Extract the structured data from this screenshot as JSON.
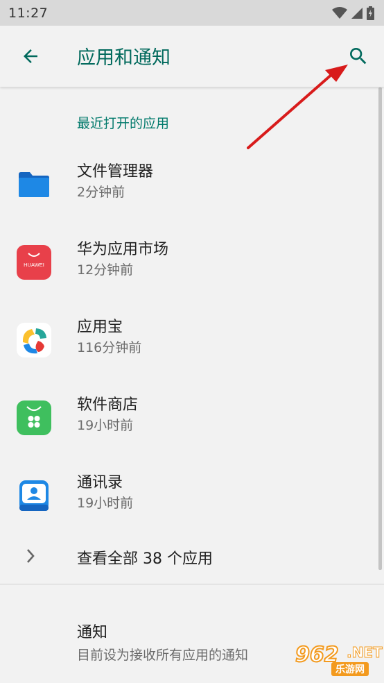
{
  "status_bar": {
    "time": "11:27"
  },
  "app_bar": {
    "title": "应用和通知"
  },
  "recent": {
    "header": "最近打开的应用",
    "apps": [
      {
        "name": "文件管理器",
        "time": "2分钟前",
        "icon": "folder-icon"
      },
      {
        "name": "华为应用市场",
        "time": "12分钟前",
        "icon": "huawei-appgallery-icon",
        "icon_text": "HUAWEI"
      },
      {
        "name": "应用宝",
        "time": "116分钟前",
        "icon": "yingyongbao-icon"
      },
      {
        "name": "软件商店",
        "time": "19小时前",
        "icon": "software-store-icon"
      },
      {
        "name": "通讯录",
        "time": "19小时前",
        "icon": "contacts-icon"
      }
    ]
  },
  "see_all": {
    "label": "查看全部 38 个应用"
  },
  "notifications": {
    "title": "通知",
    "summary": "目前设为接收所有应用的通知"
  },
  "watermark": {
    "number": "962",
    "suffix": ".NET",
    "chinese": "乐游网"
  },
  "colors": {
    "accent": "#00796b",
    "title": "#00695c",
    "arrow": "#d81b1b"
  }
}
